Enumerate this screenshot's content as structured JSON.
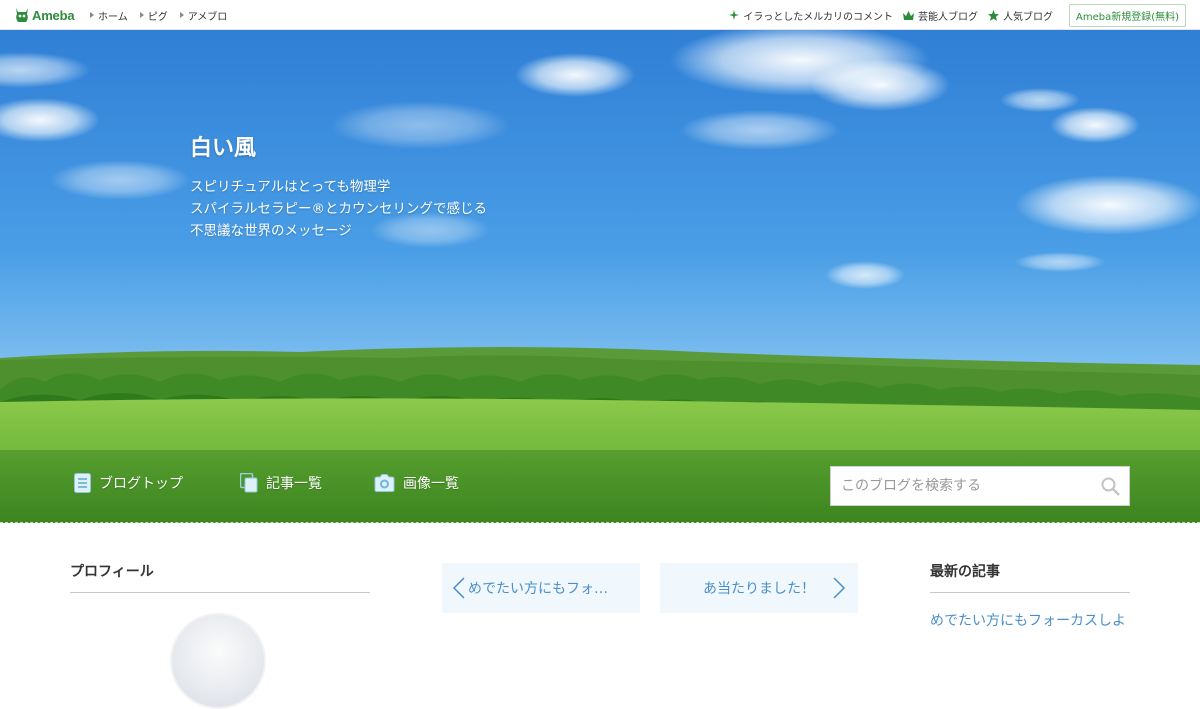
{
  "topbar": {
    "logo_text": "Ameba",
    "nav": [
      {
        "label": "ホーム"
      },
      {
        "label": "ピグ"
      },
      {
        "label": "アメブロ"
      }
    ],
    "right_links": [
      {
        "label": "イラっとしたメルカリのコメント",
        "icon": "sparkle-icon"
      },
      {
        "label": "芸能人ブログ",
        "icon": "crown-icon"
      },
      {
        "label": "人気ブログ",
        "icon": "star-icon"
      }
    ],
    "signup_label": "Ameba新規登録(無料)"
  },
  "blog": {
    "title": "白い風",
    "description_lines": [
      "スピリチュアルはとっても物理学",
      "スパイラルセラピー®とカウンセリングで感じる",
      "不思議な世界のメッセージ"
    ]
  },
  "blog_nav": {
    "items": [
      {
        "label": "ブログトップ",
        "icon": "document-icon"
      },
      {
        "label": "記事一覧",
        "icon": "copy-icon"
      },
      {
        "label": "画像一覧",
        "icon": "camera-icon"
      }
    ],
    "search": {
      "placeholder": "このブログを検索する",
      "value": ""
    }
  },
  "sidebar_left": {
    "heading": "プロフィール"
  },
  "article_nav": {
    "prev_label": "めでたい方にもフォ…",
    "next_label": "あ当たりました！"
  },
  "sidebar_right": {
    "heading": "最新の記事",
    "latest": [
      {
        "title": "めでたい方にもフォーカスしよ"
      }
    ]
  },
  "colors": {
    "brand_green": "#2d8c3c",
    "link_blue": "#4a8fca",
    "pager_bg": "#f1f8fd"
  }
}
